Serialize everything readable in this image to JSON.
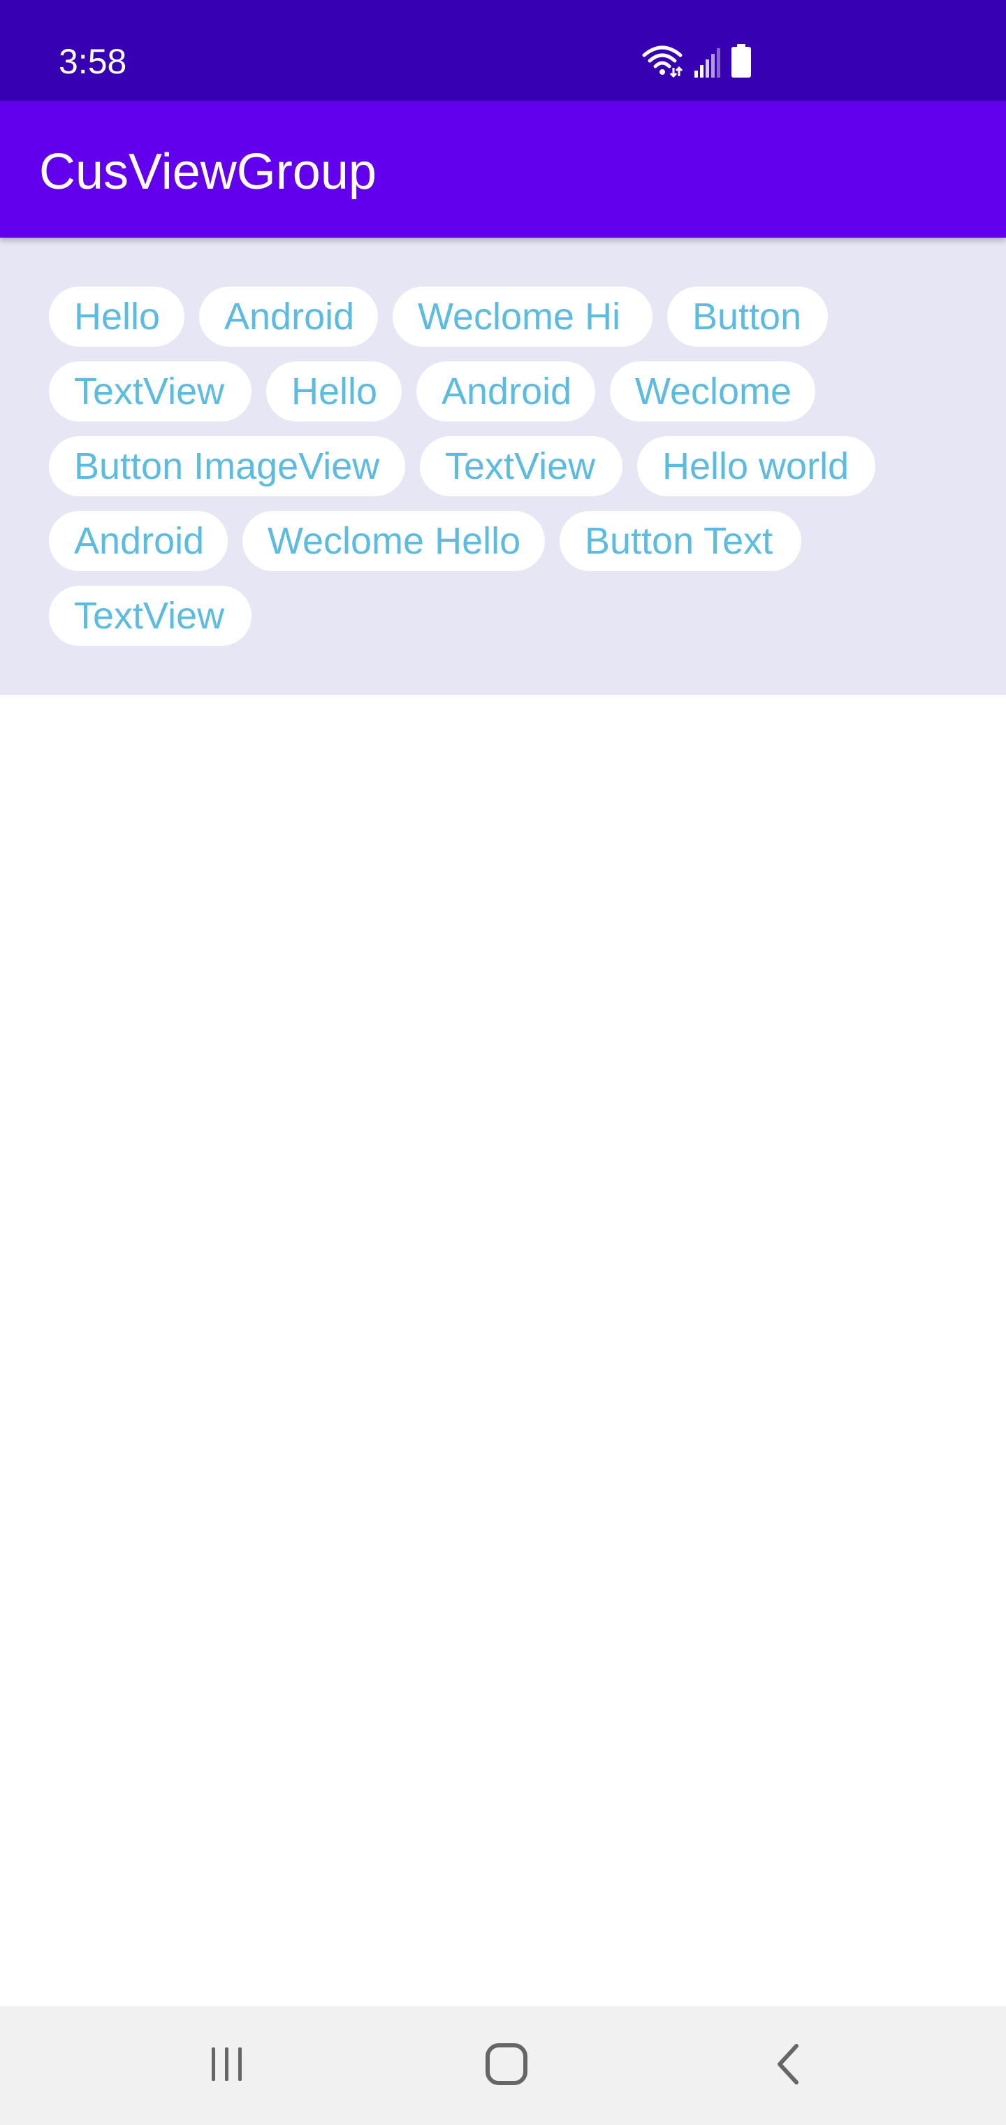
{
  "status_bar": {
    "time": "3:58",
    "icons": [
      "wifi-icon",
      "signal-icon",
      "battery-icon"
    ]
  },
  "app_bar": {
    "title": "CusViewGroup"
  },
  "tags": [
    "Hello",
    "Android",
    "Weclome Hi ",
    "Button",
    "TextView",
    "Hello",
    "Android",
    "Weclome",
    "Button ImageView",
    "TextView",
    "Hello world",
    "Android",
    "Weclome Hello",
    "Button Text",
    "TextView"
  ],
  "nav_bar": {
    "icons": [
      "recent-apps-icon",
      "home-icon",
      "back-icon"
    ]
  },
  "colors": {
    "status_bar": "#3700b3",
    "app_bar": "#6200ee",
    "tags_background": "#e6e6f5",
    "tag_text": "#5bbbe0",
    "tag_background": "#ffffff"
  }
}
